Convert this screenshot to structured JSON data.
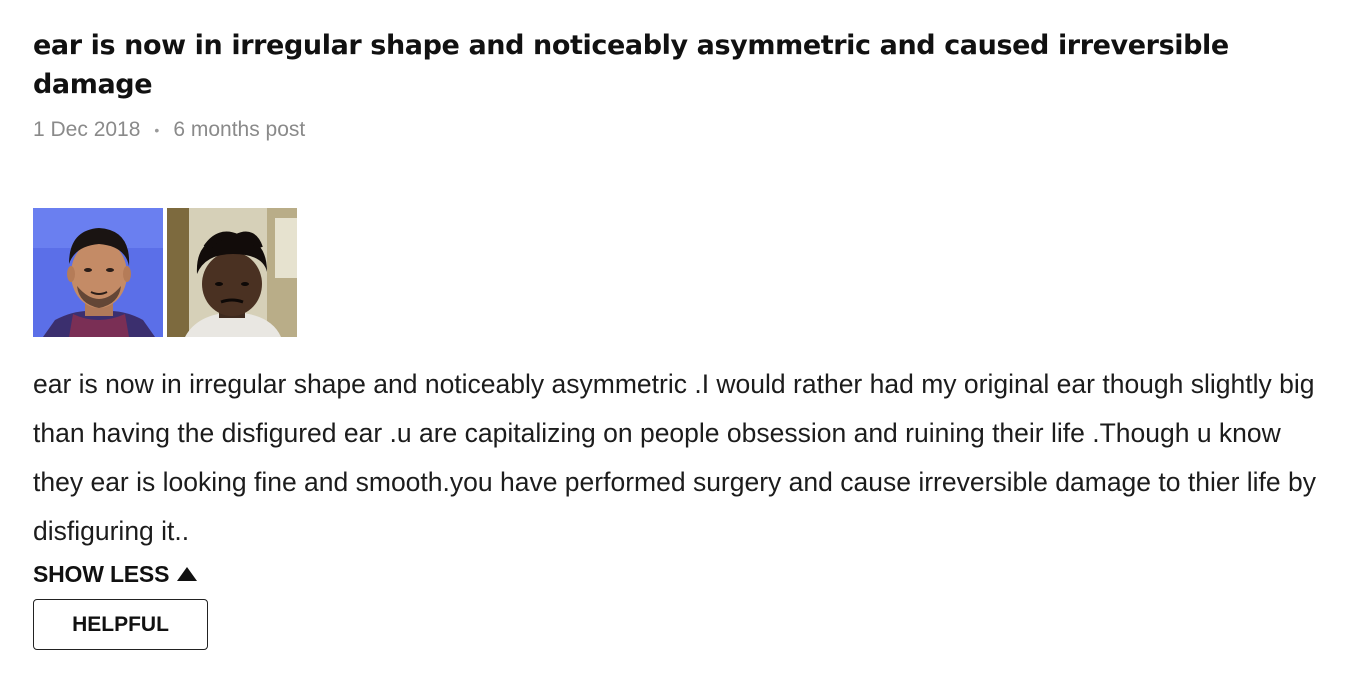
{
  "review": {
    "title": "ear is now in irregular shape and noticeably asymmetric and caused irreversible damage",
    "date": "1 Dec 2018",
    "separator": "•",
    "post_timing": "6 months post",
    "photos": [
      {
        "name": "review-photo-1",
        "background": "#5b6fe8"
      },
      {
        "name": "review-photo-2",
        "background": "#c9c2a8"
      }
    ],
    "body": "ear is now in irregular shape and noticeably asymmetric .I would rather had my original ear though slightly big than having the disfigured ear .u are capitalizing on people obsession and ruining their life .Though u know they ear is looking fine and smooth.you have performed surgery and cause irreversible damage to thier life by disfiguring it..",
    "show_less_label": "SHOW LESS",
    "helpful_label": "HELPFUL"
  },
  "colors": {
    "text": "#1c1c1c",
    "meta": "#8a8a8a",
    "button_border": "#222222"
  },
  "icons": {
    "show_less": "caret-up-icon"
  }
}
